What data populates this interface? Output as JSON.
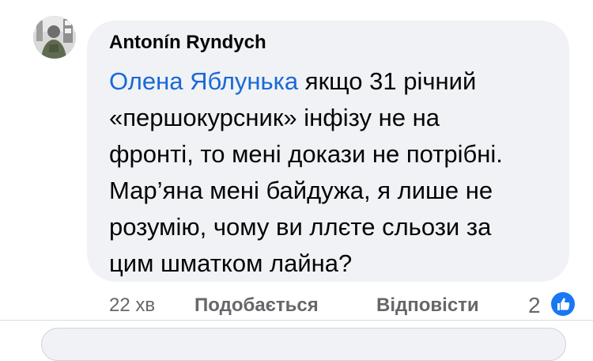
{
  "comment": {
    "author": "Antonín Ryndych",
    "mention": "Олена Яблунька",
    "lines": [
      " якщо 31 річний",
      "«першокурсник» інфізу не на",
      "фронті, то мені докази не потрібні.",
      "Мар’яна мені байдужа, я лише не",
      "розумію, чому ви ллєте сльози за",
      "цим шматком лайна?"
    ],
    "time": "22 хв",
    "like_label": "Подобається",
    "reply_label": "Відповісти",
    "reaction_count": "2",
    "reaction_icon": "thumbs-up-icon"
  },
  "colors": {
    "mention": "#1968d8",
    "bubble": "#f0f2f5",
    "secondary_text": "#65676b",
    "like_blue": "#1877f2"
  }
}
